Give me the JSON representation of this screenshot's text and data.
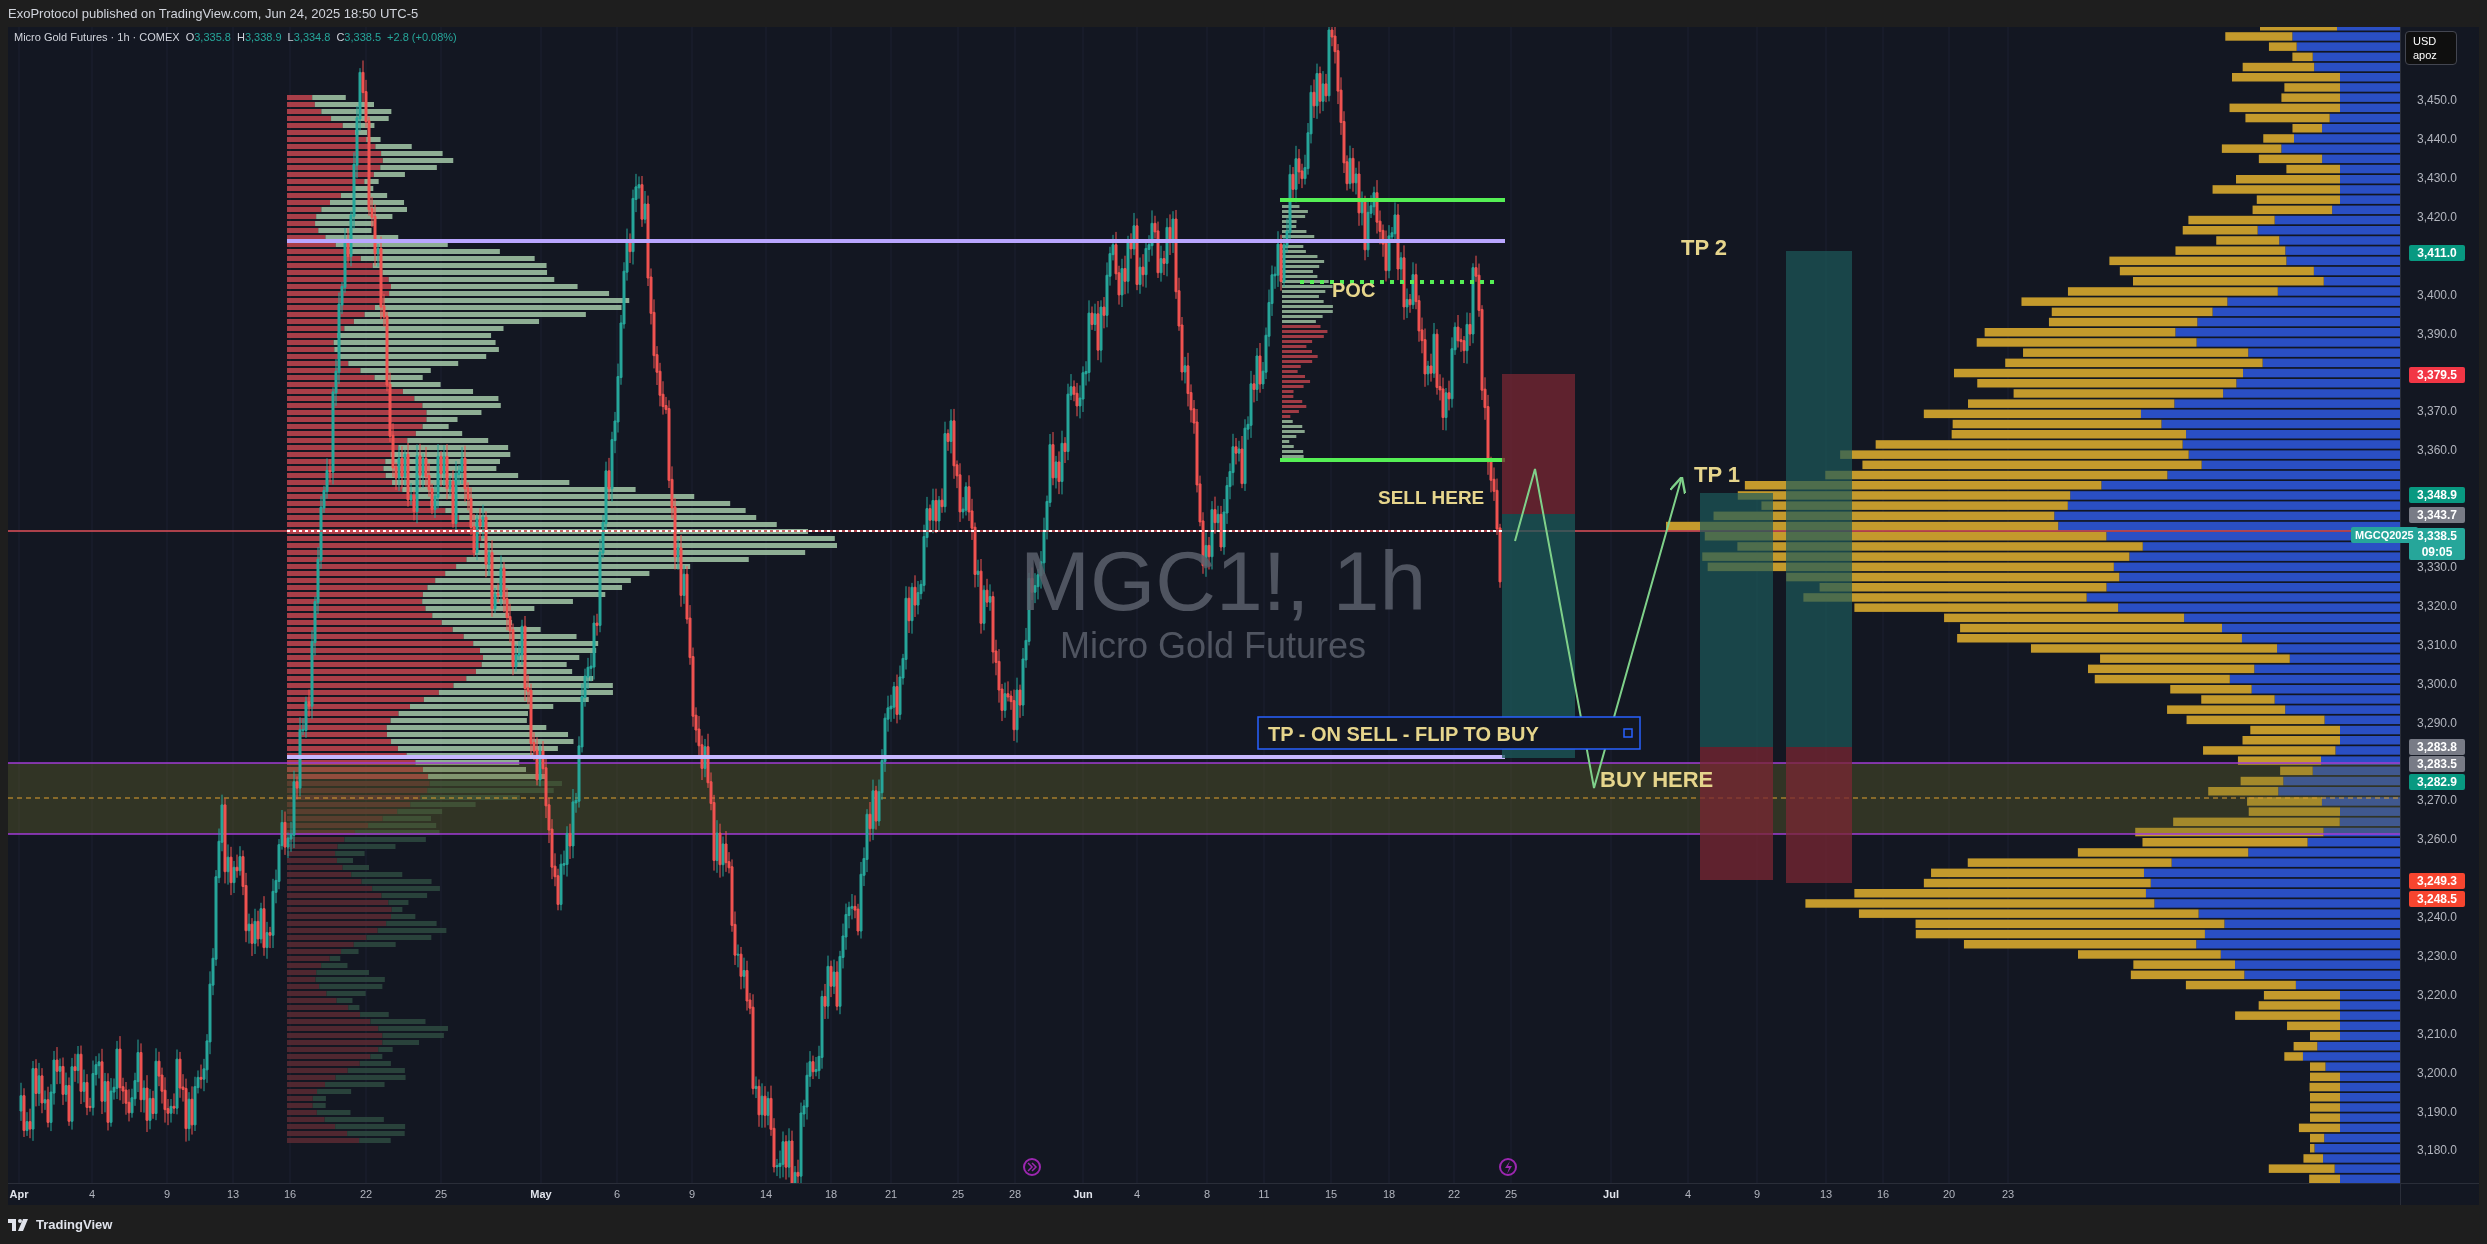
{
  "header": {
    "published": "ExoProtocol published on TradingView.com, Jun 24, 2025 18:50 UTC-5"
  },
  "legend": {
    "title": "Micro Gold Futures · 1h · COMEX",
    "ohlc": [
      {
        "label": "O",
        "value": "3,335.8"
      },
      {
        "label": "H",
        "value": "3,338.9"
      },
      {
        "label": "L",
        "value": "3,334.8"
      },
      {
        "label": "C",
        "value": "3,338.5"
      }
    ],
    "change": "+2.8 (+0.08%)"
  },
  "watermark": {
    "symbol": "MGC1!, 1h",
    "name": "Micro Gold Futures"
  },
  "annotations": [
    {
      "kind": "label",
      "text": "TP 2"
    },
    {
      "kind": "label",
      "text": "POC"
    },
    {
      "kind": "label",
      "text": "TP 1"
    },
    {
      "kind": "label",
      "text": "SELL HERE"
    },
    {
      "kind": "boxed",
      "text": "TP - ON SELL - FLIP TO BUY"
    },
    {
      "kind": "label",
      "text": "BUY HERE"
    }
  ],
  "price_axis": {
    "currency": "USD",
    "unit": "apoz",
    "symbol_tag": "MGCQ2025",
    "ticks": [
      "3,450.0",
      "3,440.0",
      "3,430.0",
      "3,420.0",
      "3,400.0",
      "3,390.0",
      "3,370.0",
      "3,360.0",
      "3,330.0",
      "3,320.0",
      "3,310.0",
      "3,300.0",
      "3,290.0",
      "3,270.0",
      "3,260.0",
      "3,240.0",
      "3,230.0",
      "3,220.0",
      "3,210.0",
      "3,200.0",
      "3,190.0",
      "3,180.0"
    ],
    "badges": [
      {
        "text": "3,411.0",
        "color": "#089981"
      },
      {
        "text": "3,379.5",
        "color": "#f23645"
      },
      {
        "text": "3,348.9",
        "color": "#089981"
      },
      {
        "text": "3,343.7",
        "color": "#787b86"
      },
      {
        "text": "3,338.5",
        "subtext": "09:05",
        "color": "#26a69a"
      },
      {
        "text": "3,283.8",
        "color": "#787b86"
      },
      {
        "text": "3,283.5",
        "color": "#787b86"
      },
      {
        "text": "3,282.9",
        "color": "#089981"
      },
      {
        "text": "3,249.3",
        "color": "#f7452f"
      },
      {
        "text": "3,248.5",
        "color": "#f7452f"
      }
    ]
  },
  "time_axis": {
    "labels": [
      {
        "text": "Apr",
        "kind": "month"
      },
      {
        "text": "4",
        "kind": "day"
      },
      {
        "text": "9",
        "kind": "day"
      },
      {
        "text": "13",
        "kind": "day"
      },
      {
        "text": "16",
        "kind": "day"
      },
      {
        "text": "22",
        "kind": "day"
      },
      {
        "text": "25",
        "kind": "day"
      },
      {
        "text": "May",
        "kind": "month"
      },
      {
        "text": "6",
        "kind": "day"
      },
      {
        "text": "9",
        "kind": "day"
      },
      {
        "text": "14",
        "kind": "day"
      },
      {
        "text": "18",
        "kind": "day"
      },
      {
        "text": "21",
        "kind": "day"
      },
      {
        "text": "25",
        "kind": "day"
      },
      {
        "text": "28",
        "kind": "day"
      },
      {
        "text": "Jun",
        "kind": "month"
      },
      {
        "text": "4",
        "kind": "day"
      },
      {
        "text": "8",
        "kind": "day"
      },
      {
        "text": "11",
        "kind": "day"
      },
      {
        "text": "15",
        "kind": "day"
      },
      {
        "text": "18",
        "kind": "day"
      },
      {
        "text": "22",
        "kind": "day"
      },
      {
        "text": "25",
        "kind": "day"
      },
      {
        "text": "Jul",
        "kind": "month"
      },
      {
        "text": "4",
        "kind": "day"
      },
      {
        "text": "9",
        "kind": "day"
      },
      {
        "text": "13",
        "kind": "day"
      },
      {
        "text": "16",
        "kind": "day"
      },
      {
        "text": "20",
        "kind": "day"
      },
      {
        "text": "23",
        "kind": "day"
      }
    ]
  },
  "footer": {
    "brand": "TradingView"
  }
}
